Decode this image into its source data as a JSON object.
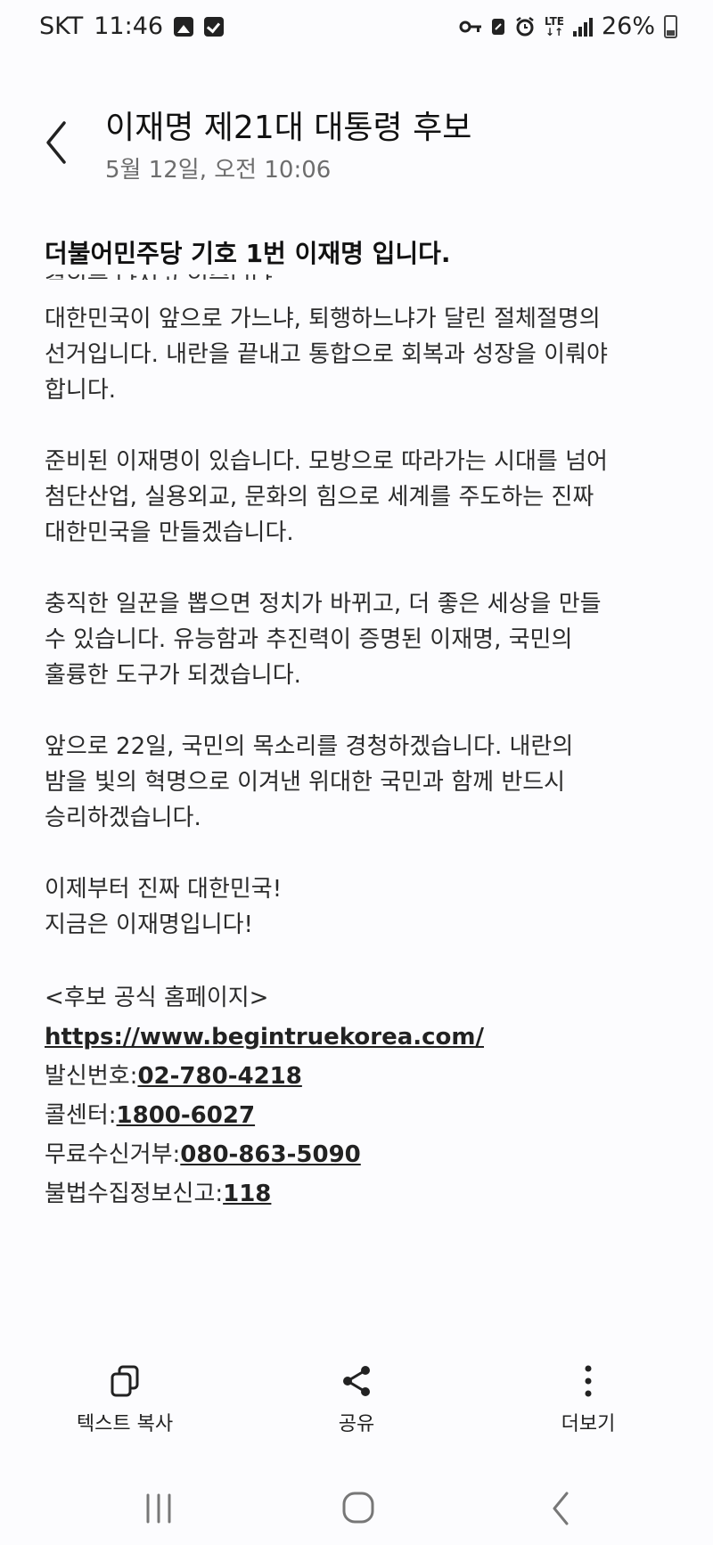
{
  "status": {
    "carrier": "SKT",
    "time": "11:46",
    "network": "LTE",
    "battery": "26%"
  },
  "header": {
    "title": "이재명 제21대 대통령 후보",
    "datetime": "5월 12일, 오전 10:06"
  },
  "message": {
    "sender_line": "더불어민주당 기호 1번 이재명 입니다.",
    "cutoff_line": "결의를 다지고 있습니다.",
    "paragraphs": [
      [
        "대한민국이 앞으로 가느냐, 퇴행하느냐가 달린 절체절명의",
        "선거입니다. 내란을 끝내고 통합으로 회복과 성장을 이뤄야",
        "합니다."
      ],
      [
        "준비된 이재명이 있습니다. 모방으로 따라가는 시대를 넘어",
        "첨단산업, 실용외교, 문화의 힘으로 세계를 주도하는 진짜",
        "대한민국을 만들겠습니다."
      ],
      [
        "충직한 일꾼을 뽑으면 정치가 바뀌고, 더 좋은 세상을 만들",
        "수 있습니다. 유능함과 추진력이 증명된 이재명, 국민의",
        "훌륭한 도구가 되겠습니다."
      ],
      [
        "앞으로 22일, 국민의 목소리를 경청하겠습니다. 내란의",
        "밤을 빛의 혁명으로 이겨낸 위대한 국민과 함께 반드시",
        "승리하겠습니다."
      ],
      [
        "이제부터 진짜 대한민국!",
        "지금은 이재명입니다!"
      ]
    ],
    "homepage_label": "<후보 공식 홈페이지>",
    "homepage_url": "https://www.begintruekorea.com/",
    "sender_no_label": "발신번호:",
    "sender_no": "02-780-4218",
    "callcenter_label": "콜센터:",
    "callcenter_no": "1800-6027",
    "optout_label": "무료수신거부:",
    "optout_no": "080-863-5090",
    "report_label": "불법수집정보신고:",
    "report_no": "118"
  },
  "actions": {
    "copy_label": "텍스트 복사",
    "share_label": "공유",
    "more_label": "더보기"
  }
}
